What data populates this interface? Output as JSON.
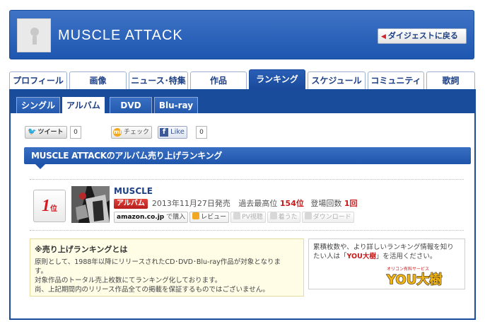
{
  "header": {
    "artist": "MUSCLE ATTACK",
    "back_label": "ダイジェストに戻る"
  },
  "tabs": [
    {
      "label": "プロフィール"
    },
    {
      "label": "画像"
    },
    {
      "label": "ニュース･特集"
    },
    {
      "label": "作品"
    },
    {
      "label": "ランキング"
    },
    {
      "label": "スケジュール"
    },
    {
      "label": "コミュニティ"
    },
    {
      "label": "歌詞"
    }
  ],
  "active_tab": "ランキング",
  "subtabs": [
    {
      "label": "シングル"
    },
    {
      "label": "アルバム"
    },
    {
      "label": "DVD"
    },
    {
      "label": "Blu-ray"
    }
  ],
  "active_subtab": "アルバム",
  "social": {
    "tweet_label": "ツイート",
    "tweet_count": "0",
    "check_label": "チェック",
    "check_icon": "mi",
    "like_label": "Like",
    "like_icon": "f",
    "like_count": "0"
  },
  "section_title": "MUSCLE ATTACKのアルバム売り上げランキング",
  "ranking": {
    "rank": "1",
    "rank_unit": "位",
    "album": "MUSCLE",
    "badge": "アルバム",
    "release": "2013年11月27日発売",
    "peak_label": "過去最高位",
    "peak_value": "154位",
    "count_label": "登場回数",
    "count_value": "1回",
    "buttons": {
      "amazon": "amazon.co.jp",
      "amazon_sub": "で購入",
      "review": "レビュー",
      "pv": "PV視聴",
      "chaku": "着うた",
      "download": "ダウンロード"
    }
  },
  "note": {
    "title": "※売り上げランキングとは",
    "lines": [
      "原則として、1988年以降にリリースされたCD･DVD･Blu-ray作品が対象となりま",
      "す。",
      "対象作品のトータル売上枚数にてランキング化しております。",
      "尚、上記期間内のリリース作品全ての掲載を保証するものではございません。"
    ]
  },
  "you_box": {
    "text_pre": "累積枚数や、より詳しいランキング情報を知りたい人は「",
    "text_hl": "YOU大樹",
    "text_post": "」を活用ください。",
    "logo_text": "YOU大樹",
    "logo_sub": "オリコン有料サービス"
  },
  "colors": {
    "primary": "#1a4c9c",
    "accent_red": "#d8161e"
  }
}
